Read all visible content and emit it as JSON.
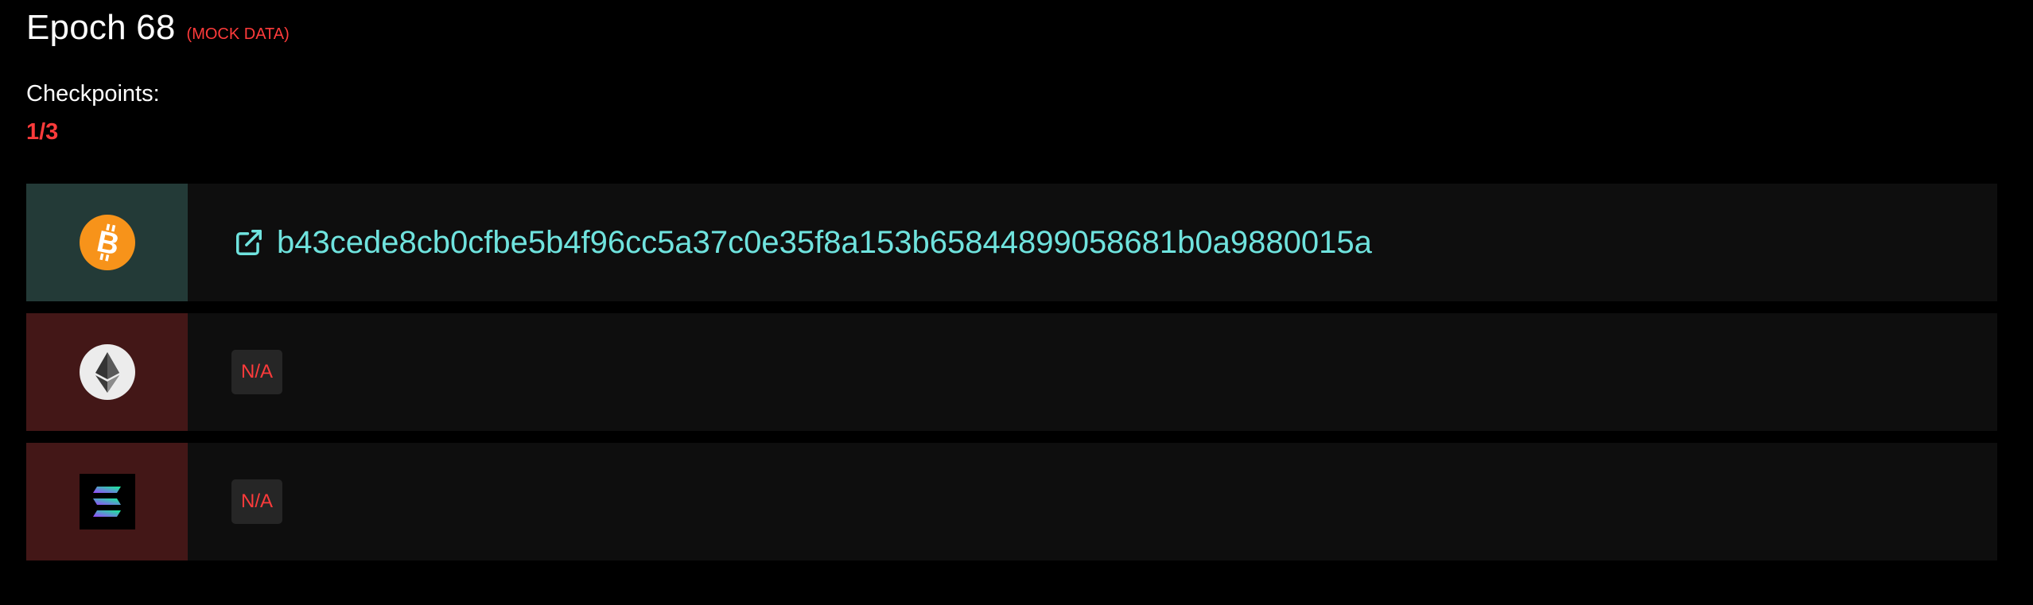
{
  "header": {
    "title": "Epoch 68",
    "mock_label": "(MOCK DATA)"
  },
  "checkpoints": {
    "label": "Checkpoints:",
    "count": "1/3"
  },
  "chains": [
    {
      "icon": "bitcoin-icon",
      "status": "ok",
      "hash": "b43cede8cb0cfbe5b4f96cc5a37c0e35f8a153b65844899058681b0a9880015a"
    },
    {
      "icon": "ethereum-icon",
      "status": "missing",
      "value": "N/A"
    },
    {
      "icon": "solana-icon",
      "status": "missing",
      "value": "N/A"
    }
  ],
  "colors": {
    "background": "#000000",
    "row_background": "#0e0e0e",
    "ok_cell": "#233a37",
    "missing_cell": "#431717",
    "accent_red": "#ff3b3b",
    "hash_cyan": "#6fe3de",
    "bitcoin_orange": "#f7931a"
  }
}
